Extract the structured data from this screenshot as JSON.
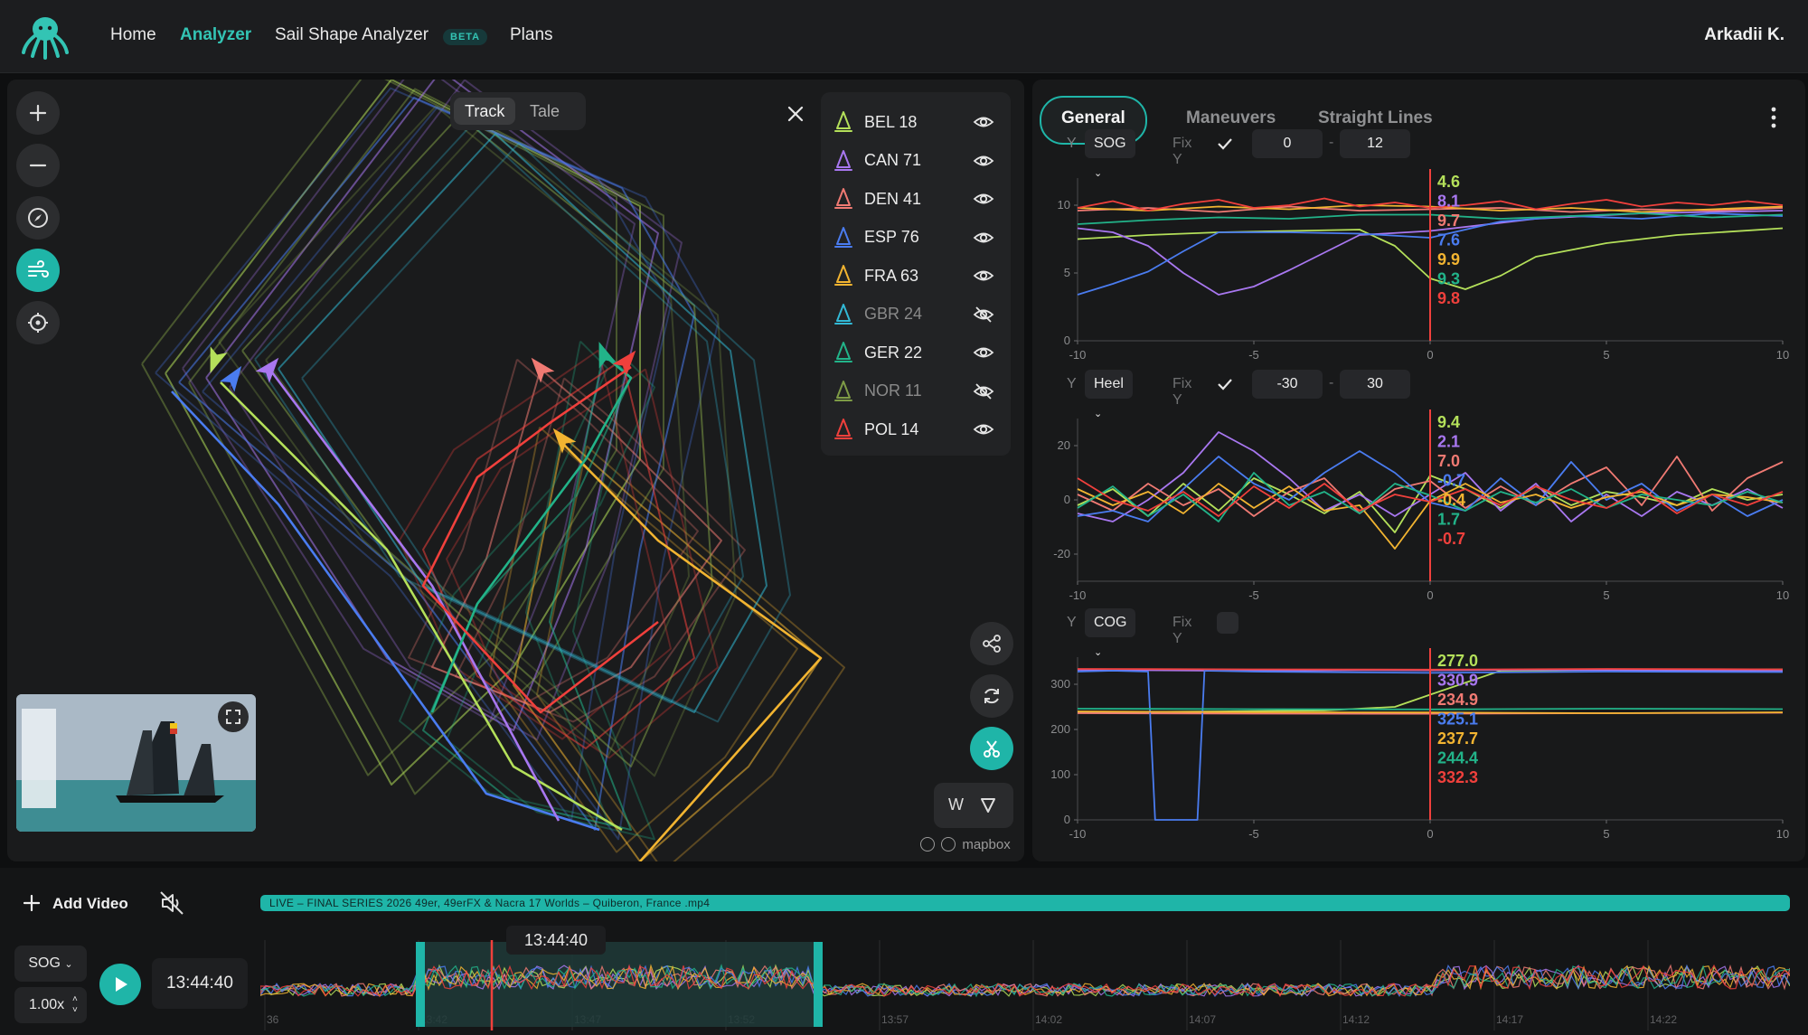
{
  "nav": {
    "home": "Home",
    "analyzer": "Analyzer",
    "sail_shape": "Sail Shape Analyzer",
    "beta": "BETA",
    "plans": "Plans",
    "user": "Arkadii K."
  },
  "map": {
    "toggle_track": "Track",
    "toggle_tale": "Tale",
    "wind_label": "W",
    "attribution": "mapbox",
    "boats": [
      {
        "name": "BEL 18",
        "color": "#b4e05a",
        "visible": true
      },
      {
        "name": "CAN 71",
        "color": "#a877f0",
        "visible": true
      },
      {
        "name": "DEN 41",
        "color": "#f07a73",
        "visible": true
      },
      {
        "name": "ESP 76",
        "color": "#4a7cf0",
        "visible": true
      },
      {
        "name": "FRA 63",
        "color": "#f2b431",
        "visible": true
      },
      {
        "name": "GBR 24",
        "color": "#32b9d6",
        "visible": false
      },
      {
        "name": "GER 22",
        "color": "#22b389",
        "visible": true
      },
      {
        "name": "NOR 11",
        "color": "#7e9b46",
        "visible": false
      },
      {
        "name": "POL 14",
        "color": "#f0403c",
        "visible": true
      }
    ]
  },
  "panel": {
    "tabs": [
      "General",
      "Maneuvers",
      "Straight Lines"
    ],
    "y_label": "Y",
    "fix_label": "Fix Y",
    "charts": [
      {
        "metric": "SOG",
        "fix": true,
        "min": "0",
        "max": "12"
      },
      {
        "metric": "Heel",
        "fix": true,
        "min": "-30",
        "max": "30"
      },
      {
        "metric": "COG",
        "fix": false,
        "min": "",
        "max": ""
      }
    ]
  },
  "chart_data": [
    {
      "type": "line",
      "ylabel": "SOG",
      "xlim": [
        -10,
        10
      ],
      "ylim": [
        0,
        12
      ],
      "x_ticks": [
        "-10",
        "-5",
        "0",
        "5",
        "10"
      ],
      "y_ticks": [
        "0",
        "5",
        "10"
      ],
      "cursor_values": [
        {
          "value": "4.6",
          "color": "#b4e05a"
        },
        {
          "value": "8.1",
          "color": "#a877f0"
        },
        {
          "value": "9.7",
          "color": "#f07a73"
        },
        {
          "value": "7.6",
          "color": "#4a7cf0"
        },
        {
          "value": "9.9",
          "color": "#f2b431"
        },
        {
          "value": "9.3",
          "color": "#22b389"
        },
        {
          "value": "9.8",
          "color": "#f0403c"
        }
      ],
      "series": [
        {
          "color": "#b4e05a",
          "x": [
            -10,
            -8,
            -6,
            -4,
            -2,
            -1,
            0,
            1,
            2,
            3,
            5,
            7,
            10
          ],
          "y": [
            7.5,
            7.8,
            8.0,
            8.1,
            8.2,
            7.0,
            4.6,
            3.8,
            4.8,
            6.2,
            7.2,
            7.8,
            8.3
          ]
        },
        {
          "color": "#a877f0",
          "x": [
            -10,
            -9,
            -8,
            -7,
            -6,
            -5,
            -4,
            -2,
            0,
            3,
            6,
            10
          ],
          "y": [
            8.3,
            8.0,
            7.0,
            5.0,
            3.4,
            4.0,
            5.2,
            7.8,
            8.1,
            9.0,
            9.4,
            9.6
          ]
        },
        {
          "color": "#f07a73",
          "x": [
            -10,
            -8,
            -6,
            -4,
            -2,
            0,
            2,
            4,
            6,
            8,
            10
          ],
          "y": [
            9.6,
            9.8,
            9.5,
            9.9,
            9.6,
            9.7,
            9.8,
            9.5,
            9.7,
            9.6,
            9.8
          ]
        },
        {
          "color": "#4a7cf0",
          "x": [
            -10,
            -9,
            -8,
            -7,
            -6,
            -4,
            -2,
            0,
            2,
            4,
            6,
            8,
            10
          ],
          "y": [
            3.4,
            4.2,
            5.1,
            6.6,
            8.0,
            8.0,
            7.9,
            7.6,
            8.8,
            9.2,
            9.0,
            9.4,
            9.2
          ]
        },
        {
          "color": "#f2b431",
          "x": [
            -10,
            -8,
            -6,
            -4,
            -2,
            0,
            2,
            4,
            6,
            8,
            10
          ],
          "y": [
            9.8,
            9.6,
            9.9,
            9.7,
            10.0,
            9.9,
            9.6,
            9.8,
            9.5,
            9.7,
            9.9
          ]
        },
        {
          "color": "#22b389",
          "x": [
            -10,
            -8,
            -6,
            -4,
            -2,
            0,
            2,
            4,
            6,
            8,
            10
          ],
          "y": [
            8.6,
            8.9,
            9.1,
            9.0,
            9.3,
            9.3,
            9.0,
            9.2,
            9.4,
            9.1,
            9.3
          ]
        },
        {
          "color": "#f0403c",
          "x": [
            -10,
            -9,
            -8,
            -7,
            -6,
            -5,
            -4,
            -3,
            -2,
            -1,
            0,
            1,
            2,
            3,
            4,
            5,
            6,
            7,
            8,
            9,
            10
          ],
          "y": [
            9.8,
            10.3,
            9.6,
            10.1,
            10.4,
            9.8,
            10.0,
            10.5,
            9.9,
            10.2,
            9.8,
            10.0,
            10.3,
            9.7,
            10.1,
            10.4,
            9.9,
            10.2,
            10.0,
            10.3,
            10.0
          ]
        }
      ]
    },
    {
      "type": "line",
      "ylabel": "Heel",
      "xlim": [
        -10,
        10
      ],
      "ylim": [
        -30,
        30
      ],
      "x_ticks": [
        "-10",
        "-5",
        "0",
        "5",
        "10"
      ],
      "y_ticks": [
        "-20",
        "0",
        "20"
      ],
      "cursor_values": [
        {
          "value": "9.4",
          "color": "#b4e05a"
        },
        {
          "value": "2.1",
          "color": "#a877f0"
        },
        {
          "value": "7.0",
          "color": "#f07a73"
        },
        {
          "value": "-0.7",
          "color": "#4a7cf0"
        },
        {
          "value": "-0.4",
          "color": "#f2b431"
        },
        {
          "value": "1.7",
          "color": "#22b389"
        },
        {
          "value": "-0.7",
          "color": "#f0403c"
        }
      ],
      "series": [
        {
          "color": "#b4e05a",
          "x": [
            -10,
            -9,
            -8,
            -7,
            -6,
            -5,
            -4,
            -3,
            -2,
            -1,
            0,
            1,
            2,
            3,
            4,
            5,
            6,
            7,
            8,
            9,
            10
          ],
          "y": [
            -2,
            4,
            -6,
            6,
            -4,
            8,
            2,
            -5,
            3,
            -12,
            9,
            4,
            -3,
            5,
            -2,
            3,
            1,
            -2,
            4,
            0,
            2
          ]
        },
        {
          "color": "#a877f0",
          "x": [
            -10,
            -9,
            -8,
            -7,
            -6,
            -5,
            -4,
            -3,
            -2,
            -1,
            0,
            1,
            2,
            3,
            4,
            5,
            6,
            7,
            8,
            9,
            10
          ],
          "y": [
            -5,
            -8,
            0,
            10,
            25,
            18,
            8,
            -4,
            2,
            -6,
            2,
            10,
            -4,
            6,
            -8,
            2,
            -6,
            3,
            -2,
            4,
            -3
          ]
        },
        {
          "color": "#f07a73",
          "x": [
            -10,
            -9,
            -8,
            -7,
            -6,
            -5,
            -4,
            -3,
            -2,
            -1,
            0,
            1,
            2,
            3,
            4,
            5,
            6,
            7,
            8,
            9,
            10
          ],
          "y": [
            2,
            -4,
            6,
            -2,
            4,
            -6,
            3,
            8,
            -5,
            4,
            7,
            -3,
            5,
            -2,
            6,
            12,
            -2,
            16,
            -4,
            8,
            14
          ]
        },
        {
          "color": "#4a7cf0",
          "x": [
            -10,
            -9,
            -8,
            -7,
            -6,
            -5,
            -4,
            -3,
            -2,
            -1,
            0,
            1,
            2,
            3,
            4,
            5,
            6,
            7,
            8,
            9,
            10
          ],
          "y": [
            -6,
            -4,
            -8,
            4,
            16,
            6,
            0,
            10,
            18,
            10,
            -1,
            -4,
            8,
            -2,
            14,
            0,
            6,
            -4,
            2,
            -6,
            0
          ]
        },
        {
          "color": "#f2b431",
          "x": [
            -10,
            -9,
            -8,
            -7,
            -6,
            -5,
            -4,
            -3,
            -2,
            -1,
            0,
            1,
            2,
            3,
            4,
            5,
            6,
            7,
            8,
            9,
            10
          ],
          "y": [
            4,
            -2,
            3,
            -5,
            6,
            -3,
            5,
            -4,
            -2,
            -18,
            -0.4,
            6,
            -1,
            2,
            -3,
            1,
            3,
            -2,
            2,
            1,
            -1
          ]
        },
        {
          "color": "#22b389",
          "x": [
            -10,
            -9,
            -8,
            -7,
            -6,
            -5,
            -4,
            -3,
            -2,
            -1,
            0,
            1,
            2,
            3,
            4,
            5,
            6,
            7,
            8,
            9,
            10
          ],
          "y": [
            -3,
            5,
            -6,
            2,
            -8,
            10,
            -2,
            3,
            -5,
            6,
            1.7,
            -4,
            3,
            -1,
            4,
            -3,
            2,
            0,
            -2,
            3,
            -1
          ]
        },
        {
          "color": "#f0403c",
          "x": [
            -10,
            -9,
            -8,
            -7,
            -6,
            -5,
            -4,
            -3,
            -2,
            -1,
            0,
            1,
            2,
            3,
            4,
            5,
            6,
            7,
            8,
            9,
            10
          ],
          "y": [
            8,
            0,
            -4,
            3,
            -6,
            5,
            -3,
            6,
            -4,
            2,
            -0.7,
            4,
            -2,
            5,
            0,
            -3,
            4,
            -5,
            2,
            -2,
            3
          ]
        }
      ]
    },
    {
      "type": "line",
      "ylabel": "COG",
      "xlim": [
        -10,
        10
      ],
      "ylim": [
        0,
        360
      ],
      "x_ticks": [
        "-10",
        "-5",
        "0",
        "5",
        "10"
      ],
      "y_ticks": [
        "0",
        "100",
        "200",
        "300"
      ],
      "cursor_values": [
        {
          "value": "277.0",
          "color": "#b4e05a"
        },
        {
          "value": "330.9",
          "color": "#a877f0"
        },
        {
          "value": "234.9",
          "color": "#f07a73"
        },
        {
          "value": "325.1",
          "color": "#4a7cf0"
        },
        {
          "value": "237.7",
          "color": "#f2b431"
        },
        {
          "value": "244.4",
          "color": "#22b389"
        },
        {
          "value": "332.3",
          "color": "#f0403c"
        }
      ],
      "series": [
        {
          "color": "#b4e05a",
          "x": [
            -10,
            -6,
            -3,
            -1,
            0,
            2,
            5,
            10
          ],
          "y": [
            238,
            240,
            242,
            250,
            277,
            330,
            332,
            333
          ]
        },
        {
          "color": "#a877f0",
          "x": [
            -10,
            -6,
            -2,
            0,
            3,
            6,
            10
          ],
          "y": [
            332,
            330,
            331,
            330.9,
            332,
            331,
            330
          ]
        },
        {
          "color": "#f07a73",
          "x": [
            -10,
            -5,
            0,
            5,
            10
          ],
          "y": [
            236,
            235,
            234.9,
            236,
            237
          ]
        },
        {
          "color": "#4a7cf0",
          "x": [
            -10,
            -9,
            -8,
            -7.8,
            -6.6,
            -6.4,
            -5,
            0,
            5,
            10
          ],
          "y": [
            328,
            330,
            328,
            0,
            0,
            330,
            328,
            325.1,
            328,
            327
          ]
        },
        {
          "color": "#f2b431",
          "x": [
            -10,
            -5,
            0,
            5,
            10
          ],
          "y": [
            240,
            238,
            237.7,
            236,
            238
          ]
        },
        {
          "color": "#22b389",
          "x": [
            -10,
            -5,
            0,
            5,
            10
          ],
          "y": [
            246,
            245,
            244.4,
            246,
            245
          ]
        },
        {
          "color": "#f0403c",
          "x": [
            -10,
            -5,
            0,
            5,
            10
          ],
          "y": [
            334,
            333,
            332.3,
            334,
            333
          ]
        }
      ]
    }
  ],
  "bottom": {
    "add_video": "Add Video",
    "video_title": "LIVE – FINAL SERIES 2026 49er, 49erFX & Nacra 17 Worlds – Quiberon, France .mp4",
    "cursor_time": "13:44:40",
    "metric": "SOG",
    "speed": "1.00x",
    "clock": "13:44:40",
    "timeline_ticks": [
      "36",
      "13:42",
      "13:47",
      "13:52",
      "13:57",
      "14:02",
      "14:07",
      "14:12",
      "14:17",
      "14:22"
    ]
  }
}
